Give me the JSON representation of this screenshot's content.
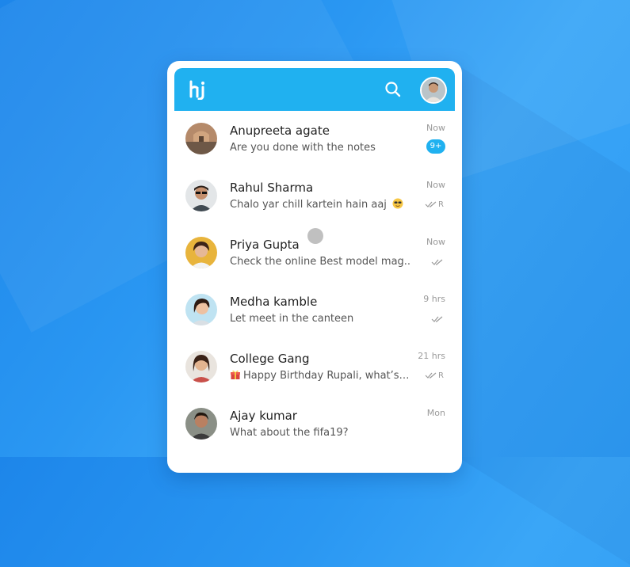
{
  "app": {
    "logo_text": "hi",
    "brand_color": "#20b1f0"
  },
  "header": {
    "search_icon": "search-icon",
    "profile_icon": "profile-avatar"
  },
  "chats": [
    {
      "name": "Anupreeta agate",
      "message": "Are you done with the notes",
      "time": "Now",
      "unread": "9+",
      "status": ""
    },
    {
      "name": "Rahul Sharma",
      "message": "Chalo yar chill kartein hain aaj",
      "emoji": "sunglasses-emoji",
      "time": "Now",
      "status": "R"
    },
    {
      "name": "Priya Gupta",
      "message": "Check the online Best model mag..",
      "time": "Now",
      "status": ""
    },
    {
      "name": "Medha kamble",
      "message": "Let meet in the canteen",
      "time": "9 hrs",
      "status": ""
    },
    {
      "name": "College Gang",
      "message": "Happy Birthday Rupali, what’s…",
      "emoji": "gift-emoji",
      "time": "21 hrs",
      "status": "R"
    },
    {
      "name": "Ajay kumar",
      "message": "What about the fifa19?",
      "time": "Mon",
      "status": ""
    }
  ]
}
